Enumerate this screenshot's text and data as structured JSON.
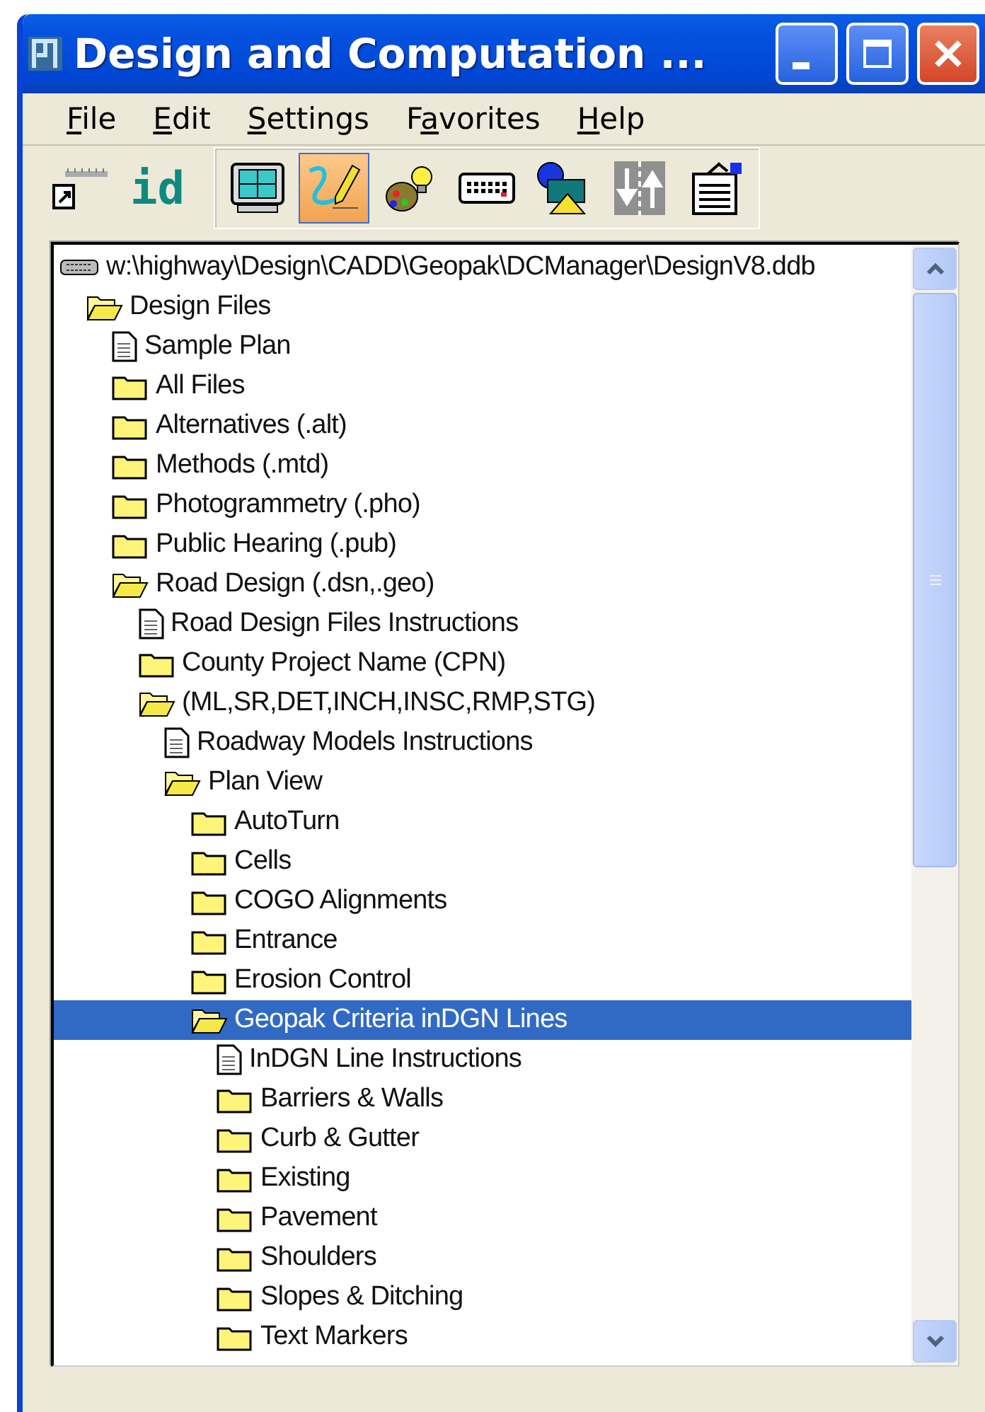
{
  "window": {
    "title": "Design and Computation ..."
  },
  "menu": [
    {
      "accesskey": "F",
      "after": "ile"
    },
    {
      "accesskey": "E",
      "after": "dit"
    },
    {
      "accesskey": "S",
      "after": "ettings"
    },
    {
      "before": "F",
      "accesskey": "a",
      "after": "vorites"
    },
    {
      "accesskey": "H",
      "after": "elp"
    }
  ],
  "toolbar": {
    "loose": [
      {
        "kind": "ruler"
      },
      {
        "kind": "id",
        "label": "id"
      }
    ],
    "group": [
      {
        "kind": "monitor",
        "selected": false
      },
      {
        "kind": "pencil",
        "selected": true
      },
      {
        "kind": "palette",
        "selected": false
      },
      {
        "kind": "keyboard",
        "selected": false
      },
      {
        "kind": "shapes",
        "selected": false
      },
      {
        "kind": "arrows",
        "selected": false
      },
      {
        "kind": "clipboard",
        "selected": false
      }
    ]
  },
  "tree": {
    "items": [
      {
        "kind": "drive",
        "label": "w:\\highway\\Design\\CADD\\Geopak\\DCManager\\DesignV8.ddb",
        "selected": false,
        "children": [
          {
            "kind": "folder",
            "label": "Design Files",
            "expanded": true,
            "selected": false,
            "children": [
              {
                "kind": "document",
                "label": "Sample Plan",
                "selected": false
              },
              {
                "kind": "folder",
                "label": "All Files",
                "expanded": false,
                "selected": false
              },
              {
                "kind": "folder",
                "label": "Alternatives (.alt)",
                "expanded": false,
                "selected": false
              },
              {
                "kind": "folder",
                "label": "Methods (.mtd)",
                "expanded": false,
                "selected": false
              },
              {
                "kind": "folder",
                "label": "Photogrammetry (.pho)",
                "expanded": false,
                "selected": false
              },
              {
                "kind": "folder",
                "label": "Public Hearing (.pub)",
                "expanded": false,
                "selected": false
              },
              {
                "kind": "folder",
                "label": "Road Design (.dsn,.geo)",
                "expanded": true,
                "selected": false,
                "children": [
                  {
                    "kind": "document",
                    "label": "Road Design Files Instructions",
                    "selected": false
                  },
                  {
                    "kind": "folder",
                    "label": "County Project Name (CPN)",
                    "expanded": false,
                    "selected": false
                  },
                  {
                    "kind": "folder",
                    "label": "(ML,SR,DET,INCH,INSC,RMP,STG)",
                    "expanded": true,
                    "selected": false,
                    "children": [
                      {
                        "kind": "document",
                        "label": "Roadway Models Instructions",
                        "selected": false
                      },
                      {
                        "kind": "folder",
                        "label": "Plan View",
                        "expanded": true,
                        "selected": false,
                        "children": [
                          {
                            "kind": "folder",
                            "label": "AutoTurn",
                            "expanded": false,
                            "selected": false
                          },
                          {
                            "kind": "folder",
                            "label": "Cells",
                            "expanded": false,
                            "selected": false
                          },
                          {
                            "kind": "folder",
                            "label": "COGO Alignments",
                            "expanded": false,
                            "selected": false
                          },
                          {
                            "kind": "folder",
                            "label": "Entrance",
                            "expanded": false,
                            "selected": false
                          },
                          {
                            "kind": "folder",
                            "label": "Erosion Control",
                            "expanded": false,
                            "selected": false
                          },
                          {
                            "kind": "folder",
                            "label": "Geopak Criteria inDGN Lines",
                            "expanded": true,
                            "selected": true,
                            "children": [
                              {
                                "kind": "document",
                                "label": "InDGN Line Instructions",
                                "selected": false
                              },
                              {
                                "kind": "folder",
                                "label": "Barriers & Walls",
                                "expanded": false,
                                "selected": false
                              },
                              {
                                "kind": "folder",
                                "label": "Curb & Gutter",
                                "expanded": false,
                                "selected": false
                              },
                              {
                                "kind": "folder",
                                "label": "Existing",
                                "expanded": false,
                                "selected": false
                              },
                              {
                                "kind": "folder",
                                "label": "Pavement",
                                "expanded": false,
                                "selected": false
                              },
                              {
                                "kind": "folder",
                                "label": "Shoulders",
                                "expanded": false,
                                "selected": false
                              },
                              {
                                "kind": "folder",
                                "label": "Slopes & Ditching",
                                "expanded": false,
                                "selected": false
                              },
                              {
                                "kind": "folder",
                                "label": "Text Markers",
                                "expanded": false,
                                "selected": false
                              }
                            ]
                          }
                        ]
                      }
                    ]
                  }
                ]
              }
            ]
          }
        ]
      }
    ]
  }
}
